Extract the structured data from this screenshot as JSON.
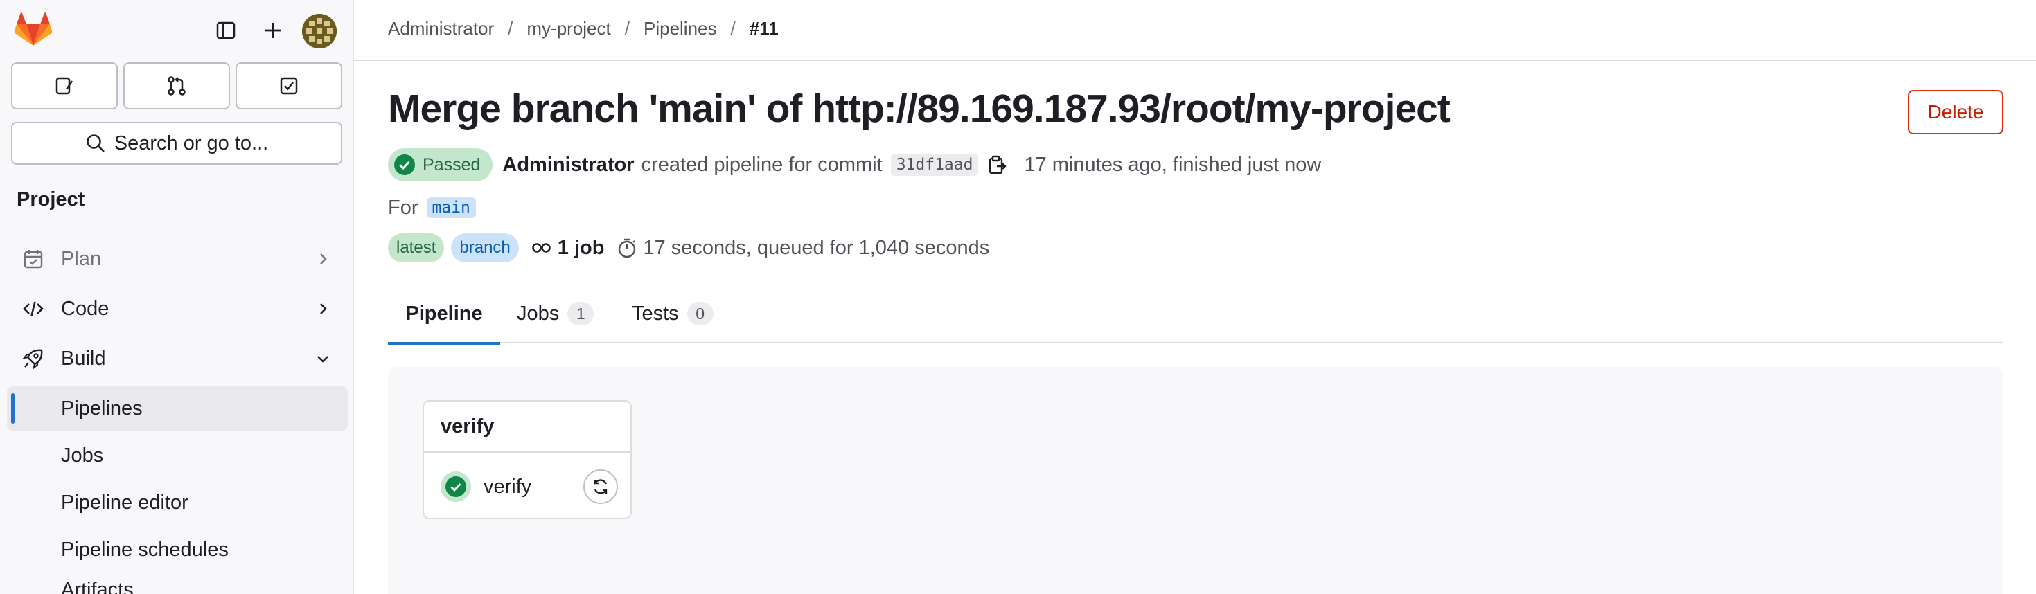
{
  "sidebar": {
    "search_label": "Search or go to...",
    "section_title": "Project",
    "nav": [
      {
        "label": "Plan",
        "icon": "calendar-icon"
      },
      {
        "label": "Code",
        "icon": "code-icon"
      },
      {
        "label": "Build",
        "icon": "rocket-icon"
      }
    ],
    "build_items": [
      {
        "label": "Pipelines"
      },
      {
        "label": "Jobs"
      },
      {
        "label": "Pipeline editor"
      },
      {
        "label": "Pipeline schedules"
      },
      {
        "label": "Artifacts"
      }
    ]
  },
  "breadcrumb": {
    "items": [
      "Administrator",
      "my-project",
      "Pipelines",
      "#11"
    ],
    "separator": "/"
  },
  "pipeline": {
    "title": "Merge branch 'main' of http://89.169.187.93/root/my-project",
    "delete_label": "Delete",
    "status": "Passed",
    "author": "Administrator",
    "created_text": "created pipeline for commit",
    "commit_sha": "31df1aad",
    "time_text": "17 minutes ago, finished just now",
    "for_label": "For",
    "ref": "main",
    "tags": [
      "latest",
      "branch"
    ],
    "jobs_count_text": "1 job",
    "duration_text": "17 seconds, queued for 1,040 seconds"
  },
  "tabs": [
    {
      "label": "Pipeline",
      "count": ""
    },
    {
      "label": "Jobs",
      "count": "1"
    },
    {
      "label": "Tests",
      "count": "0"
    }
  ],
  "stage": {
    "title": "verify",
    "job_name": "verify"
  },
  "colors": {
    "accent": "#1f75cb",
    "success": "#108548",
    "danger": "#dd2b0e"
  }
}
